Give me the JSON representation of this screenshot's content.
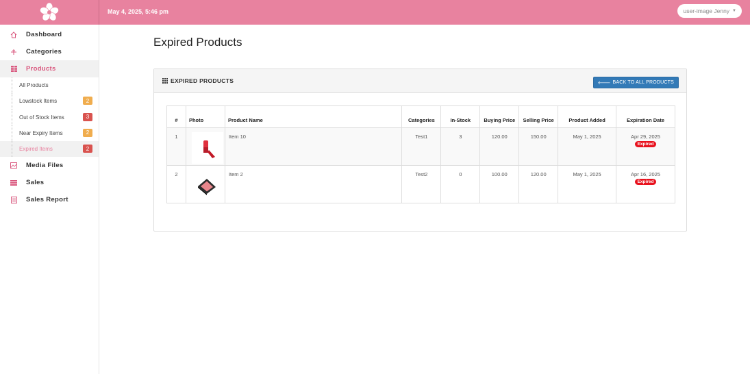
{
  "header": {
    "datetime": "May 4, 2025, 5:46 pm",
    "user_label": "user-image Jenny",
    "accent": "#e8829f"
  },
  "sidebar": {
    "items": [
      {
        "label": "Dashboard",
        "icon": "home-icon"
      },
      {
        "label": "Categories",
        "icon": "categories-icon"
      },
      {
        "label": "Products",
        "icon": "grid-icon"
      }
    ],
    "sub_items": [
      {
        "label": "All Products",
        "badge": ""
      },
      {
        "label": "Lowstock Items",
        "badge": "2"
      },
      {
        "label": "Out of Stock Items",
        "badge": "3"
      },
      {
        "label": "Near Expiry Items",
        "badge": "2"
      },
      {
        "label": "Expired Items",
        "badge": "2"
      }
    ],
    "bottom_items": [
      {
        "label": "Media Files",
        "icon": "image-icon"
      },
      {
        "label": "Sales",
        "icon": "sales-icon"
      },
      {
        "label": "Sales Report",
        "icon": "report-icon"
      }
    ]
  },
  "main": {
    "page_title": "Expired Products",
    "panel_title": "EXPIRED PRODUCTS",
    "back_button": "BACK TO ALL PRODUCTS"
  },
  "table": {
    "headers": {
      "num": "#",
      "photo": "Photo",
      "name": "Product Name",
      "category": "Categories",
      "stock": "In-Stock",
      "buy": "Buying Price",
      "sell": "Selling Price",
      "added": "Product Added",
      "expiry": "Expiration Date"
    },
    "rows": [
      {
        "num": "1",
        "name": "Item 10",
        "category": "Test1",
        "stock": "3",
        "buy": "120.00",
        "sell": "150.00",
        "added": "May 1, 2025",
        "expiry": "Apr 29, 2025",
        "status": "Expired",
        "photo": "lipstick-image"
      },
      {
        "num": "2",
        "name": "Item 2",
        "category": "Test2",
        "stock": "0",
        "buy": "100.00",
        "sell": "120.00",
        "added": "May 1, 2025",
        "expiry": "Apr 16, 2025",
        "status": "Expired",
        "photo": "compact-powder-image"
      }
    ]
  }
}
